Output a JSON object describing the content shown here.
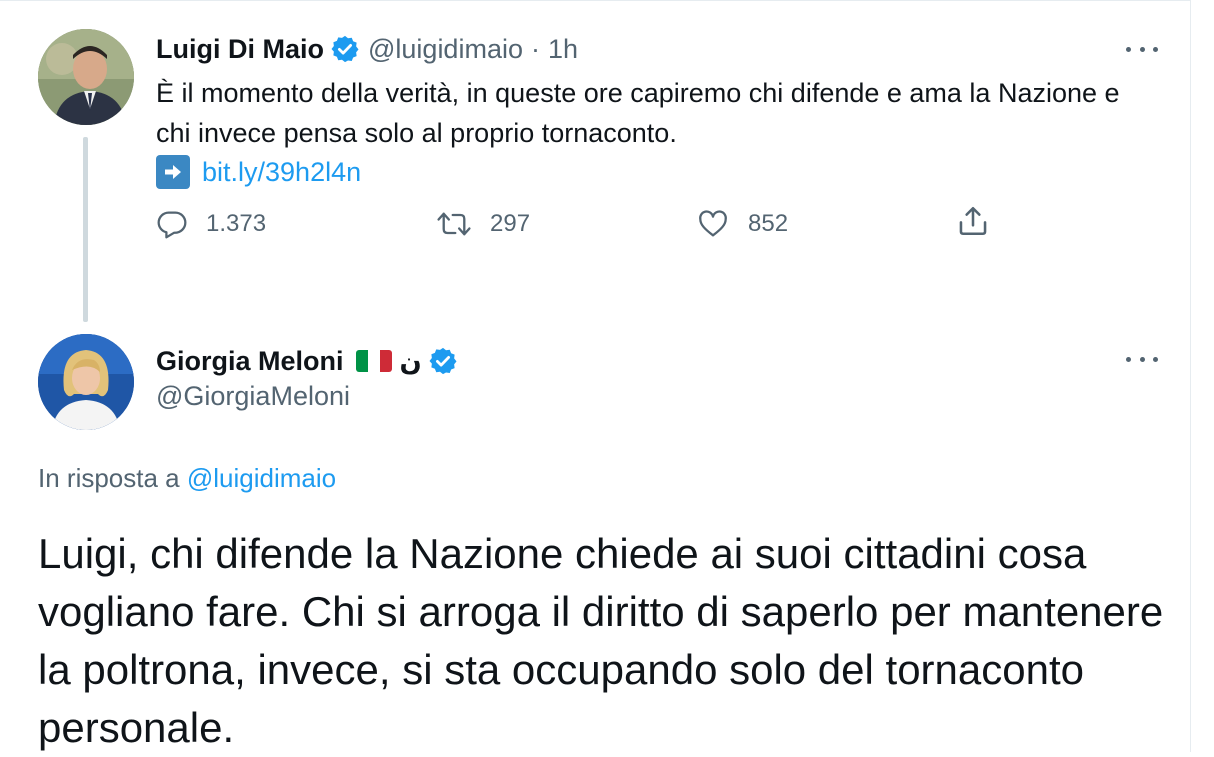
{
  "parent_tweet": {
    "author_name": "Luigi Di Maio",
    "handle": "@luigidimaio",
    "separator": "·",
    "time": "1h",
    "text": "È il momento della verità, in queste ore capiremo chi difende e ama la Nazione e chi invece pensa solo al proprio tornaconto.",
    "link": "bit.ly/39h2l4n",
    "link_icon": "right-arrow-emoji-icon",
    "actions": {
      "replies": "1.373",
      "retweets": "297",
      "likes": "852"
    }
  },
  "reply_tweet": {
    "author_name": "Giorgia Meloni",
    "name_emoji": "flag-italy",
    "name_symbol": "ن",
    "handle": "@GiorgiaMeloni",
    "in_reply_prefix": "In risposta a",
    "in_reply_handle": "@luigidimaio",
    "text": "Luigi, chi difende la Nazione chiede ai suoi cittadini cosa vogliano fare. Chi si arroga il diritto di saperlo per mantenere la poltrona, invece, si sta occupando solo del tornaconto personale."
  },
  "colors": {
    "accent": "#1d9bf0",
    "secondary_text": "#536471",
    "primary_text": "#0f1419",
    "verified_badge": "#1d9bf0",
    "thread_line": "#cfd9de"
  }
}
